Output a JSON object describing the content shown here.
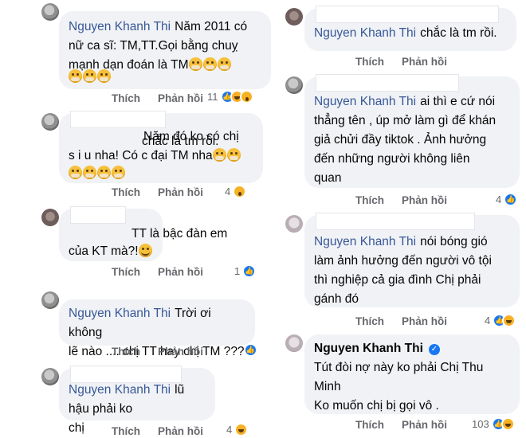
{
  "labels": {
    "like": "Thích",
    "reply": "Phản hồi"
  },
  "left": [
    {
      "name": "Nguyen Khanh Thi",
      "lines": [
        "Năm 2011 có",
        "nữ ca sĩ: TM,TT.Gọi bằng chuỵ",
        "mạnh dạn đoán là TM"
      ],
      "count": "11",
      "reactions": [
        "like",
        "haha",
        "wow"
      ]
    },
    {
      "name": "",
      "lines": [
        "Năm đó ko có chị",
        "s i u nha! Có c đại TM nha"
      ],
      "count": "4",
      "reactions": [
        "wow"
      ]
    },
    {
      "name": "",
      "lines": [
        "TT là bậc đàn em",
        "của KT mà?!"
      ],
      "count": "1",
      "reactions": [
        "like"
      ]
    },
    {
      "name": "Nguyen Khanh Thi",
      "lines": [
        "Trời ơi không",
        "lẽ nào .... chị TT hay chị TM ???"
      ],
      "count": "",
      "reactions": [
        "like"
      ]
    },
    {
      "name": "Nguyen Khanh Thi",
      "lines": [
        "lũ hậu phải ko",
        "chị"
      ],
      "count": "4",
      "reactions": [
        "haha"
      ]
    }
  ],
  "right": [
    {
      "name": "Nguyen Khanh Thi",
      "lines": [
        "chắc là tm rồi."
      ],
      "count": "",
      "reactions": []
    },
    {
      "name": "Nguyen Khanh Thi",
      "lines": [
        "ai thì e cứ nói",
        "thẳng tên , úp mở làm gì để khán",
        "giả chửi đầy tiktok . Ảnh hưởng",
        "đến những người không liên",
        "quan"
      ],
      "count": "4",
      "reactions": [
        "like"
      ]
    },
    {
      "name": "Nguyen Khanh Thi",
      "lines": [
        "nói bóng gió",
        "làm ảnh hưởng đến người vô tội",
        "thì nghiệp cả gia đình Chị phải",
        "gánh đó"
      ],
      "count": "4",
      "reactions": [
        "like",
        "haha"
      ]
    },
    {
      "name": "Nguyen Khanh Thi",
      "lines": [
        "Tút đòi nợ này ko phải Chị Thu",
        "Minh",
        "Ko muốn chị bị gọi vô ."
      ],
      "count": "103",
      "reactions": [
        "like",
        "haha"
      ]
    }
  ]
}
